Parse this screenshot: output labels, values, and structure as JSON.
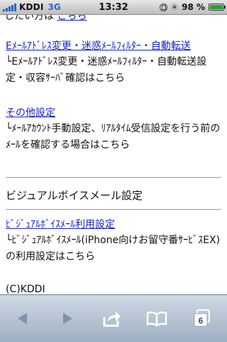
{
  "status": {
    "carrier": "KDDI",
    "network": "3G",
    "time": "13:32",
    "battery": "98 %",
    "battery_level": 0.98
  },
  "page": {
    "cut_prefix": "したい方は",
    "cut_link": "こちら",
    "sections": [
      {
        "link": "Eﾒｰﾙｱﾄﾞﾚｽ変更・迷惑ﾒｰﾙﾌｨﾙﾀｰ・自動転送",
        "desc": "└Eﾒｰﾙｱﾄﾞﾚｽ変更・迷惑ﾒｰﾙﾌｨﾙﾀｰ・自動転送設定・収容ｻｰﾊﾞ確認はこちら"
      },
      {
        "link": "その他設定",
        "desc": "└ﾒｰﾙｱｶｳﾝﾄ手動設定、ﾘｱﾙﾀｲﾑ受信設定を行う前のﾒｰﾙを確認する場合はこちら"
      }
    ],
    "heading": "ビジュアルボイスメール設定",
    "vvm": {
      "link": "ﾋﾞｼﾞｭｱﾙﾎﾞｲｽﾒｰﾙ利用設定",
      "desc": "└ﾋﾞｼﾞｭｱﾙﾎﾞｲｽﾒｰﾙ(iPhone向けお留守番ｻｰﾋﾞｽEX)の利用設定はこちら"
    },
    "copyright": "(C)KDDI"
  },
  "toolbar": {
    "tabs_count": "6",
    "icons": [
      "back-arrow-icon",
      "forward-arrow-icon",
      "share-icon",
      "bookmarks-icon",
      "tabs-icon"
    ]
  }
}
